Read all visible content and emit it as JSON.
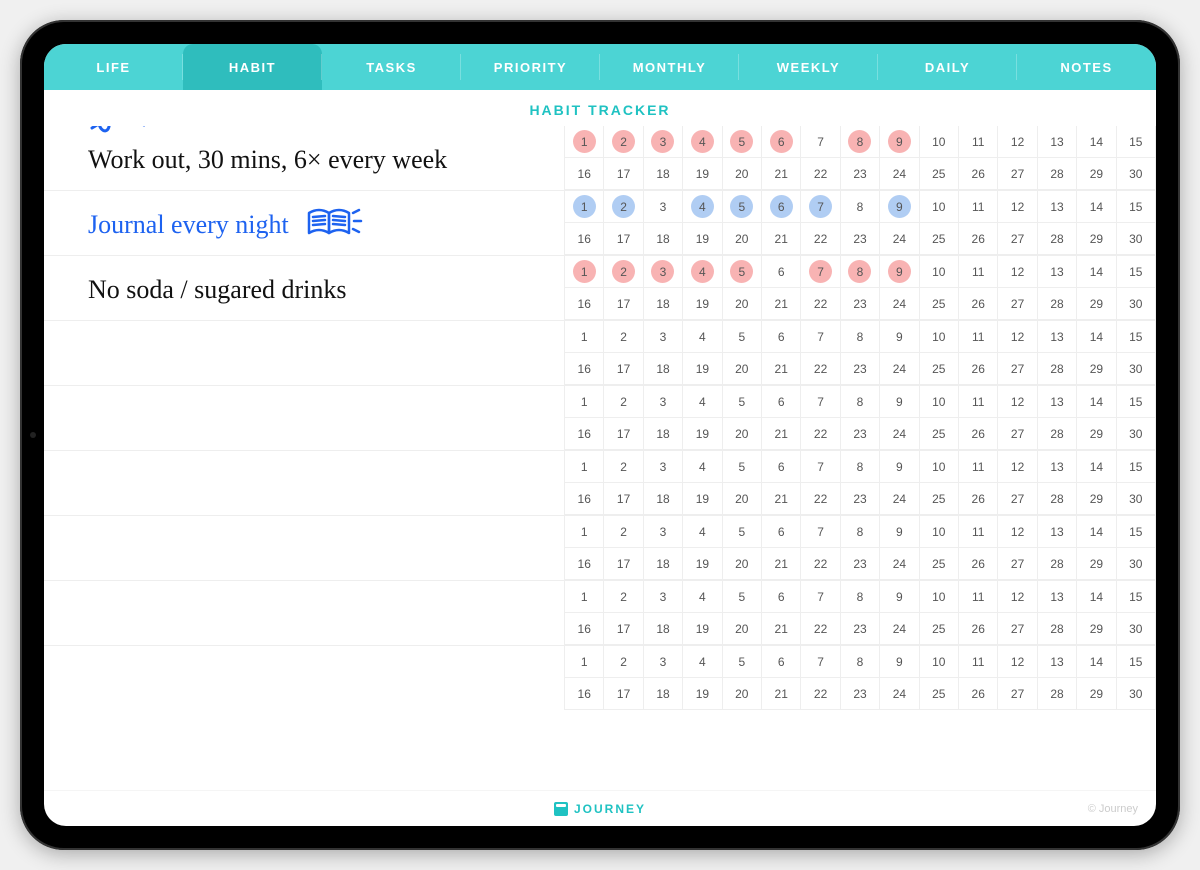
{
  "tabs": [
    {
      "label": "LIFE",
      "active": false
    },
    {
      "label": "HABIT",
      "active": true
    },
    {
      "label": "TASKS",
      "active": false
    },
    {
      "label": "PRIORITY",
      "active": false
    },
    {
      "label": "MONTHLY",
      "active": false
    },
    {
      "label": "WEEKLY",
      "active": false
    },
    {
      "label": "DAILY",
      "active": false
    },
    {
      "label": "NOTES",
      "active": false
    }
  ],
  "page_title": "HABIT TRACKER",
  "colors": {
    "accent": "#1fc2c2",
    "tab_bg": "#4cd4d4",
    "tab_active": "#2fbdbd",
    "mark_pink": "#f7a6a6",
    "mark_blue": "#a7c8f2",
    "ink_black": "#111",
    "ink_blue": "#1d62f0"
  },
  "days_per_row": 30,
  "habits": [
    {
      "text": "Work out, 30 mins, 6× every week",
      "text_color": "black",
      "doodle": "dumbbell-icon",
      "marked_days": [
        1,
        2,
        3,
        4,
        5,
        6,
        8,
        9
      ],
      "mark_color": "pink"
    },
    {
      "text": "Journal every night",
      "text_color": "blue",
      "doodle": "book-icon",
      "marked_days": [
        1,
        2,
        4,
        5,
        6,
        7,
        9
      ],
      "mark_color": "blue"
    },
    {
      "text": "No soda / sugared drinks",
      "text_color": "black",
      "doodle": null,
      "marked_days": [
        1,
        2,
        3,
        4,
        5,
        7,
        8,
        9
      ],
      "mark_color": "pink"
    },
    {
      "text": "",
      "text_color": "black",
      "doodle": null,
      "marked_days": [],
      "mark_color": "pink"
    },
    {
      "text": "",
      "text_color": "black",
      "doodle": null,
      "marked_days": [],
      "mark_color": "pink"
    },
    {
      "text": "",
      "text_color": "black",
      "doodle": null,
      "marked_days": [],
      "mark_color": "pink"
    },
    {
      "text": "",
      "text_color": "black",
      "doodle": null,
      "marked_days": [],
      "mark_color": "pink"
    },
    {
      "text": "",
      "text_color": "black",
      "doodle": null,
      "marked_days": [],
      "mark_color": "pink"
    },
    {
      "text": "",
      "text_color": "black",
      "doodle": null,
      "marked_days": [],
      "mark_color": "pink"
    }
  ],
  "footer": {
    "brand": "JOURNEY",
    "copyright": "© Journey"
  }
}
